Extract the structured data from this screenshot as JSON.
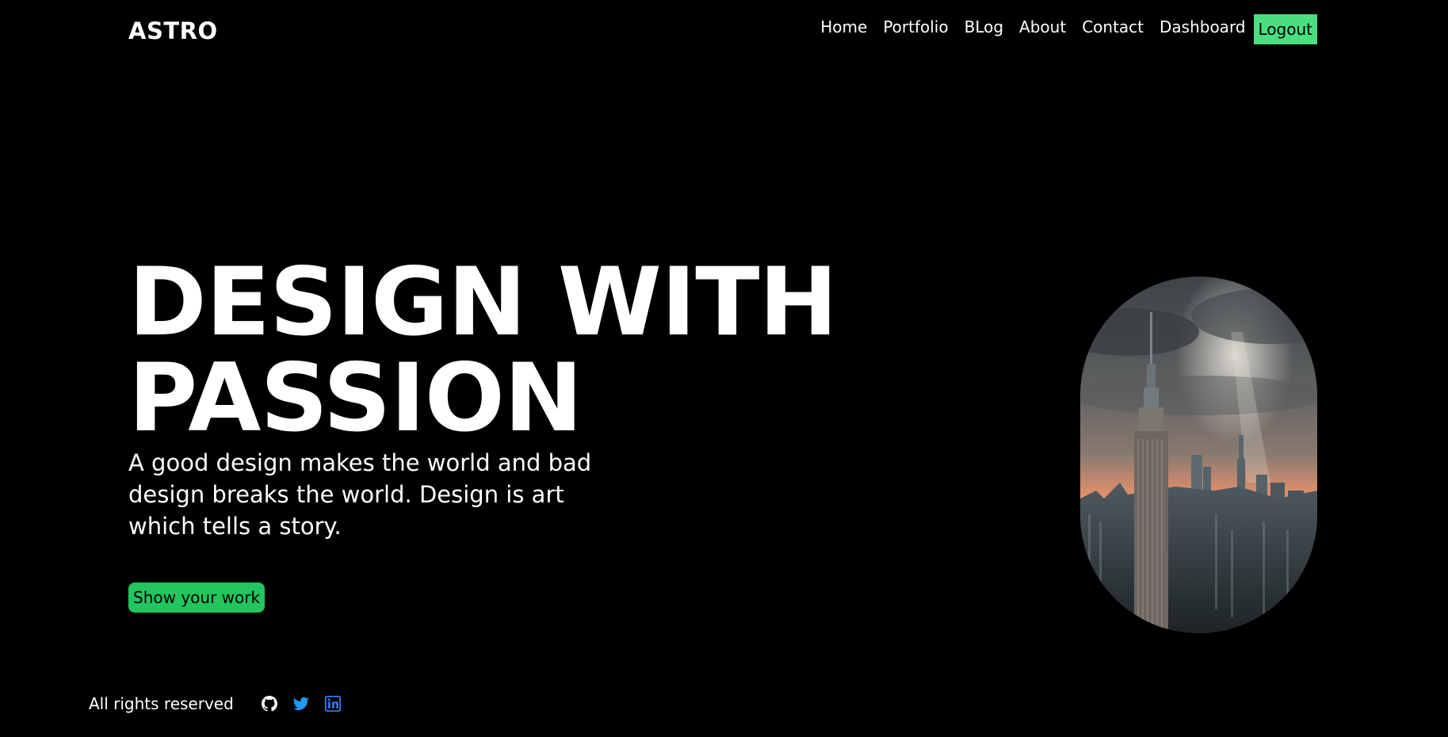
{
  "header": {
    "logo": "ASTRO",
    "nav": [
      {
        "label": "Home"
      },
      {
        "label": "Portfolio"
      },
      {
        "label": "BLog"
      },
      {
        "label": "About"
      },
      {
        "label": "Contact"
      },
      {
        "label": "Dashboard"
      }
    ],
    "logout_label": "Logout"
  },
  "hero": {
    "title_line1": "DESIGN WITH",
    "title_line2": "PASSION",
    "subtitle": "A good design makes the world and bad design breaks the world. Design is art which tells a story.",
    "cta_label": "Show your work"
  },
  "footer": {
    "text": "All rights reserved",
    "social": [
      {
        "icon": "github-icon"
      },
      {
        "icon": "twitter-icon"
      },
      {
        "icon": "linkedin-icon"
      }
    ]
  },
  "colors": {
    "background": "#000000",
    "logout_bg": "#4ade80",
    "cta_bg": "#22c55e",
    "twitter": "#1d9bf0",
    "linkedin": "#3b82f6"
  }
}
